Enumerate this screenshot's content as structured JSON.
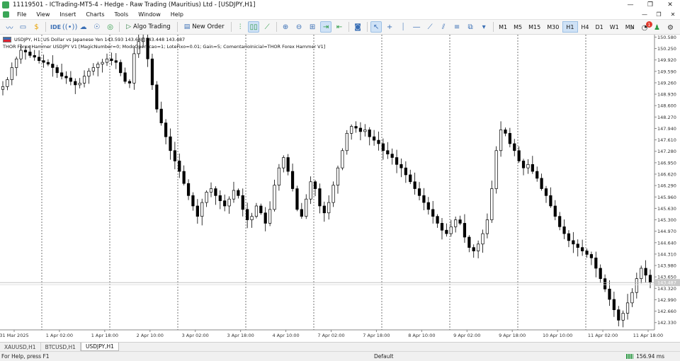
{
  "window": {
    "title": "11119501 - ICTrading-MT5-4 - Hedge - Raw Trading (Mauritius) Ltd - [USDJPY,H1]",
    "minimize": "—",
    "restore": "❐",
    "close": "✕"
  },
  "menu": {
    "items": [
      "File",
      "View",
      "Insert",
      "Charts",
      "Tools",
      "Window",
      "Help"
    ]
  },
  "toolbar": {
    "ide_label": "IDE",
    "algo_trading_label": "Algo Trading",
    "new_order_label": "New Order",
    "timeframes": [
      "M1",
      "M5",
      "M15",
      "M30",
      "H1",
      "H4",
      "D1",
      "W1",
      "MN"
    ],
    "active_timeframe": "H1",
    "notification_count": "1"
  },
  "chart": {
    "symbol_line": "USDJPY, H1:  US Dollar vs Japanese Yen   143.593  143.648  143.448  143.487",
    "ea_line": "THOR Forex Hammer USDJPY V1 [MagicNumber=0; ModoOperacao=1; LoteFixo=0.01; Gain=5; ComentarioInicial=THOR Forex Hammer V1]",
    "bg_color": "#ffffff",
    "candle_color": "#000000",
    "grid_color": "#555555",
    "current_price": "143.487",
    "current_price_label_color": "#c8c8c8"
  },
  "chart_data": {
    "type": "candlestick",
    "symbol": "USDJPY",
    "timeframe": "H1",
    "y_ticks": [
      "150.580",
      "150.250",
      "149.920",
      "149.590",
      "149.260",
      "148.930",
      "148.600",
      "148.270",
      "147.940",
      "147.610",
      "147.280",
      "146.950",
      "146.620",
      "146.290",
      "145.960",
      "145.630",
      "145.300",
      "144.970",
      "144.640",
      "144.310",
      "143.980",
      "143.650",
      "143.320",
      "142.990",
      "142.660",
      "142.330"
    ],
    "ylim": [
      142.12,
      150.65
    ],
    "x_ticks": [
      "31 Mar 2025",
      "1 Apr 02:00",
      "1 Apr 18:00",
      "2 Apr 10:00",
      "3 Apr 02:00",
      "3 Apr 18:00",
      "4 Apr 10:00",
      "7 Apr 02:00",
      "7 Apr 18:00",
      "8 Apr 10:00",
      "9 Apr 02:00",
      "9 Apr 18:00",
      "10 Apr 10:00",
      "11 Apr 02:00",
      "11 Apr 18:00"
    ],
    "day_separators": [
      "1 Apr",
      "2 Apr",
      "3 Apr",
      "4 Apr",
      "7 Apr",
      "8 Apr",
      "9 Apr",
      "10 Apr",
      "11 Apr"
    ],
    "path_close": [
      149.15,
      149.35,
      149.7,
      149.95,
      150.2,
      150.15,
      150.05,
      150.0,
      149.9,
      149.85,
      149.8,
      149.7,
      149.55,
      149.45,
      149.4,
      149.3,
      149.2,
      149.25,
      149.45,
      149.6,
      149.7,
      149.8,
      149.85,
      149.95,
      149.9,
      149.85,
      149.55,
      149.3,
      149.25,
      150.1,
      150.45,
      150.55,
      149.95,
      149.2,
      148.5,
      148.1,
      147.7,
      147.3,
      147.0,
      146.7,
      146.35,
      146.0,
      145.7,
      145.4,
      145.8,
      146.1,
      146.2,
      146.0,
      145.85,
      145.7,
      145.9,
      146.15,
      146.0,
      145.6,
      145.3,
      145.4,
      145.7,
      145.5,
      145.2,
      145.6,
      146.3,
      146.8,
      147.1,
      146.7,
      146.2,
      145.6,
      145.4,
      145.9,
      146.4,
      146.2,
      145.7,
      145.5,
      145.8,
      146.3,
      146.8,
      147.3,
      147.8,
      148.0,
      147.95,
      147.85,
      147.9,
      147.7,
      147.6,
      147.5,
      147.3,
      147.2,
      147.1,
      146.9,
      146.8,
      146.6,
      146.4,
      146.2,
      146.0,
      145.8,
      145.6,
      145.4,
      145.2,
      145.0,
      144.9,
      145.1,
      145.3,
      145.2,
      144.8,
      144.5,
      144.4,
      144.6,
      144.9,
      145.3,
      146.2,
      147.3,
      147.9,
      147.8,
      147.5,
      147.3,
      147.0,
      146.8,
      146.9,
      146.7,
      146.5,
      146.2,
      146.0,
      145.7,
      145.4,
      145.1,
      144.9,
      144.7,
      144.6,
      144.5,
      144.4,
      144.3,
      144.2,
      143.9,
      143.6,
      143.3,
      143.0,
      142.7,
      142.4,
      142.6,
      142.9,
      143.2,
      143.6,
      143.9,
      143.7,
      143.49
    ]
  },
  "tabs": {
    "items": [
      "XAUUSD,H1",
      "BTCUSD,H1",
      "USDJPY,H1"
    ],
    "active": "USDJPY,H1"
  },
  "status": {
    "help_text": "For Help, press F1",
    "profile": "Default",
    "network": "156.94 ms"
  }
}
